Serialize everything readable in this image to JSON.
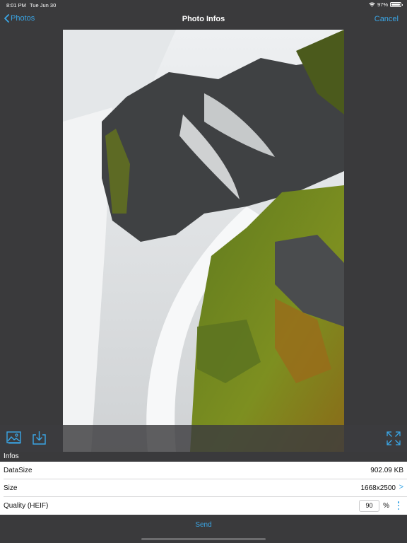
{
  "status": {
    "time": "8:01 PM",
    "date": "Tue Jun 30",
    "battery": "97%",
    "battery_level": 0.97
  },
  "nav": {
    "back_label": "Photos",
    "title": "Photo Infos",
    "cancel_label": "Cancel"
  },
  "section": {
    "header": "Infos"
  },
  "rows": {
    "datasize": {
      "label": "DataSize",
      "value": "902.09 KB"
    },
    "size": {
      "label": "Size",
      "value": "1668x2500",
      "chevron": ">"
    },
    "quality": {
      "label": "Quality (HEIF)",
      "value": "90",
      "unit": "%"
    }
  },
  "footer": {
    "send_label": "Send"
  },
  "icons": {
    "toolbar_left": [
      "image-icon",
      "download-icon"
    ],
    "toolbar_right": "expand-icon"
  },
  "colors": {
    "accent": "#3aa6e6",
    "background": "#3a3a3c",
    "row_background": "#ffffff"
  }
}
